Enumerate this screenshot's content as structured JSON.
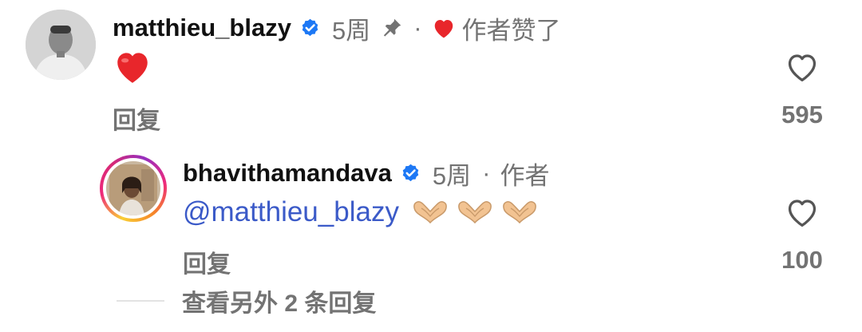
{
  "comments": [
    {
      "username": "matthieu_blazy",
      "time": "5周",
      "separator": "·",
      "author_liked": "作者赞了",
      "text_emoji": "❤️",
      "reply_label": "回复",
      "like_count": "595"
    }
  ],
  "reply": {
    "username": "bhavithamandava",
    "time": "5周",
    "separator": "·",
    "author_tag": "作者",
    "mention": "@matthieu_blazy",
    "emojis": "🫶🫶🫶",
    "reply_label": "回复",
    "like_count": "100"
  },
  "view_more": "查看另外 2 条回复",
  "colors": {
    "verified": "#1d78f5",
    "heart_red": "#e8262b",
    "gray": "#737373",
    "mention": "#3b5ac8"
  }
}
